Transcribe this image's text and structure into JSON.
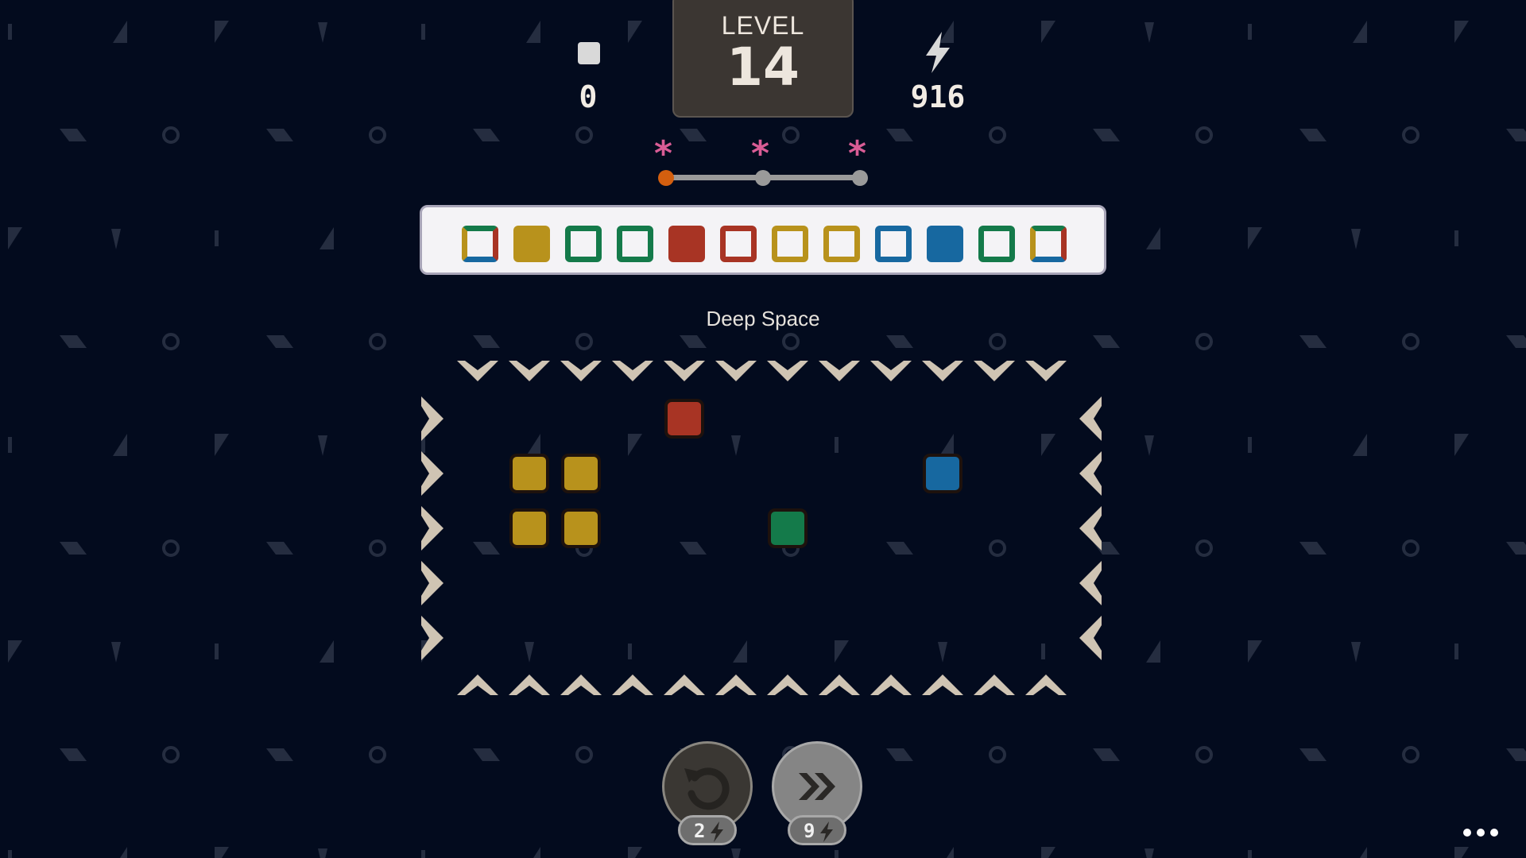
{
  "hud": {
    "moves_value": "0",
    "level_label": "LEVEL",
    "level_number": "14",
    "energy_value": "916",
    "moves_icon": "square-icon",
    "energy_icon": "lightning-icon"
  },
  "stars": {
    "symbol": "*",
    "count": 3,
    "progress_fraction": 0,
    "icon": "asterisk-star-icon"
  },
  "sequence": {
    "tiles": [
      {
        "style": "multi-outline"
      },
      {
        "style": "filled",
        "color": "#b8921c"
      },
      {
        "style": "outline",
        "color": "#147a4a"
      },
      {
        "style": "outline",
        "color": "#147a4a"
      },
      {
        "style": "filled",
        "color": "#a83424"
      },
      {
        "style": "outline",
        "color": "#a83424"
      },
      {
        "style": "outline",
        "color": "#b8921c"
      },
      {
        "style": "outline",
        "color": "#b8921c"
      },
      {
        "style": "outline",
        "color": "#1768a0"
      },
      {
        "style": "filled",
        "color": "#1768a0"
      },
      {
        "style": "outline",
        "color": "#147a4a"
      },
      {
        "style": "multi-outline"
      }
    ]
  },
  "level_name": "Deep Space",
  "board": {
    "columns": 12,
    "rows": 5,
    "top_arrows": "chevron-down-icon",
    "bottom_arrows": "chevron-up-icon",
    "left_arrows": "chevron-right-icon",
    "right_arrows": "chevron-left-icon",
    "blocks": [
      {
        "col": 4,
        "row": 0,
        "color": "#a83424"
      },
      {
        "col": 1,
        "row": 1,
        "color": "#b8921c"
      },
      {
        "col": 2,
        "row": 1,
        "color": "#b8921c"
      },
      {
        "col": 9,
        "row": 1,
        "color": "#1768a0"
      },
      {
        "col": 1,
        "row": 2,
        "color": "#b8921c"
      },
      {
        "col": 2,
        "row": 2,
        "color": "#b8921c"
      },
      {
        "col": 6,
        "row": 2,
        "color": "#147a4a"
      }
    ]
  },
  "actions": {
    "undo_cost": "2",
    "skip_cost": "9",
    "undo_icon": "undo-icon",
    "skip_icon": "double-chevron-right-icon",
    "menu_icon": "more-dots-icon"
  },
  "colors": {
    "background": "#030b1e",
    "pattern": "#2b3447",
    "yellow": "#b8921c",
    "green": "#147a4a",
    "red": "#a83424",
    "blue": "#1768a0",
    "arrow": "#cfc4b3",
    "progress": "#d35f0f"
  }
}
